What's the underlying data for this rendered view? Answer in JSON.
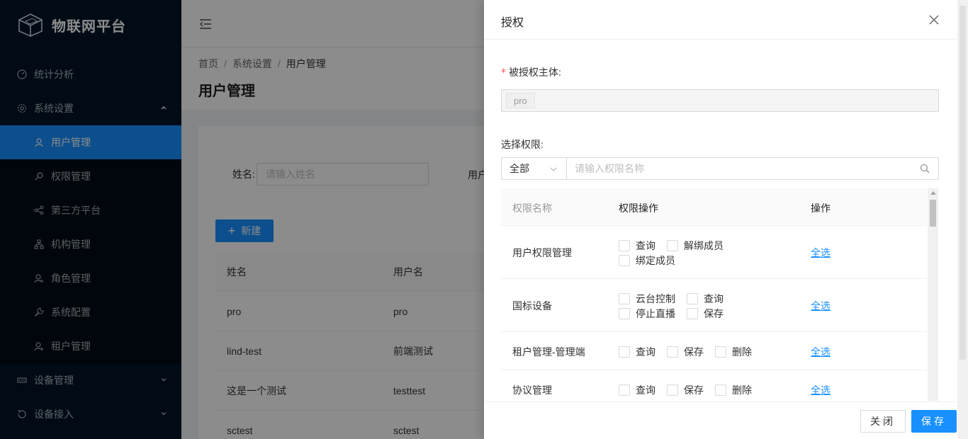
{
  "app": {
    "title": "物联网平台"
  },
  "sidebar": {
    "items": [
      {
        "label": "统计分析",
        "icon": "dashboard-icon"
      },
      {
        "label": "系统设置",
        "icon": "gear-icon"
      },
      {
        "label": "用户管理",
        "icon": "user-icon"
      },
      {
        "label": "权限管理",
        "icon": "key-icon"
      },
      {
        "label": "第三方平台",
        "icon": "share-icon"
      },
      {
        "label": "机构管理",
        "icon": "org-icon"
      },
      {
        "label": "角色管理",
        "icon": "role-icon"
      },
      {
        "label": "系统配置",
        "icon": "wrench-icon"
      },
      {
        "label": "租户管理",
        "icon": "tenant-icon"
      },
      {
        "label": "设备管理",
        "icon": "device-icon"
      },
      {
        "label": "设备接入",
        "icon": "access-icon"
      }
    ]
  },
  "breadcrumb": {
    "home": "首页",
    "level1": "系统设置",
    "current": "用户管理",
    "sep": "/"
  },
  "page": {
    "title": "用户管理"
  },
  "filter": {
    "name_label": "姓名:",
    "name_placeholder": "请输入姓名",
    "username_label": "用户"
  },
  "toolbar": {
    "new_label": "新建"
  },
  "users_table": {
    "headers": [
      "姓名",
      "用户名"
    ],
    "rows": [
      [
        "pro",
        "pro"
      ],
      [
        "lind-test",
        "前端测试"
      ],
      [
        "这是一个测试",
        "testtest"
      ],
      [
        "sctest",
        "sctest"
      ]
    ]
  },
  "drawer": {
    "title": "授权",
    "subject_label": "被授权主体:",
    "subject_tag": "pro",
    "perm_label": "选择权限:",
    "filter_value": "全部",
    "search_placeholder": "请输入权限名称",
    "table_headers": {
      "name": "权限名称",
      "ops": "权限操作",
      "action": "操作"
    },
    "rows": [
      {
        "name": "用户权限管理",
        "ops": [
          [
            "查询",
            "解绑成员"
          ],
          [
            "绑定成员"
          ]
        ],
        "select_all": "全选"
      },
      {
        "name": "国标设备",
        "ops": [
          [
            "云台控制",
            "查询"
          ],
          [
            "停止直播",
            "保存"
          ]
        ],
        "select_all": "全选"
      },
      {
        "name": "租户管理-管理端",
        "ops": [
          [
            "查询",
            "保存",
            "删除"
          ]
        ],
        "select_all": "全选"
      },
      {
        "name": "协议管理",
        "ops": [
          [
            "查询",
            "保存",
            "删除"
          ]
        ],
        "select_all": "全选"
      }
    ],
    "close_label": "关闭",
    "save_label": "保存"
  }
}
